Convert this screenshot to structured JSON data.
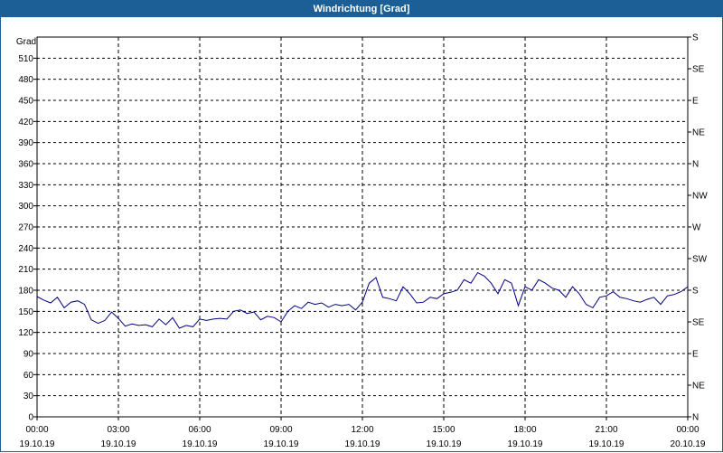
{
  "window": {
    "title": "Windrichtung [Grad]"
  },
  "chart_data": {
    "type": "line",
    "title": "Windrichtung [Grad]",
    "ylabel": "Grad",
    "ylim": [
      0,
      540
    ],
    "y_ticks": [
      0,
      30,
      60,
      90,
      120,
      150,
      180,
      210,
      240,
      270,
      300,
      330,
      360,
      390,
      420,
      450,
      480,
      510
    ],
    "y_ticks_right": [
      "N",
      "NE",
      "E",
      "SE",
      "S",
      "SW",
      "W",
      "NW",
      "N",
      "NE",
      "E",
      "SE",
      "S"
    ],
    "x_ticks": [
      {
        "time": "00:00",
        "date": "19.10.19"
      },
      {
        "time": "03:00",
        "date": "19.10.19"
      },
      {
        "time": "06:00",
        "date": "19.10.19"
      },
      {
        "time": "09:00",
        "date": "19.10.19"
      },
      {
        "time": "12:00",
        "date": "19.10.19"
      },
      {
        "time": "15:00",
        "date": "19.10.19"
      },
      {
        "time": "18:00",
        "date": "19.10.19"
      },
      {
        "time": "21:00",
        "date": "19.10.19"
      },
      {
        "time": "00:00",
        "date": "20.10.19"
      }
    ],
    "grid": true,
    "series": [
      {
        "color": "#000080",
        "x_hours": [
          0,
          0.25,
          0.5,
          0.75,
          1,
          1.25,
          1.5,
          1.75,
          2,
          2.25,
          2.5,
          2.75,
          3,
          3.25,
          3.5,
          3.75,
          4,
          4.25,
          4.5,
          4.75,
          5,
          5.25,
          5.5,
          5.75,
          6,
          6.25,
          6.5,
          6.75,
          7,
          7.25,
          7.5,
          7.75,
          8,
          8.25,
          8.5,
          8.75,
          9,
          9.25,
          9.5,
          9.75,
          10,
          10.25,
          10.5,
          10.75,
          11,
          11.25,
          11.5,
          11.75,
          12,
          12.25,
          12.5,
          12.75,
          13,
          13.25,
          13.5,
          13.75,
          14,
          14.25,
          14.5,
          14.75,
          15,
          15.25,
          15.5,
          15.75,
          16,
          16.25,
          16.5,
          16.75,
          17,
          17.25,
          17.5,
          17.75,
          18,
          18.25,
          18.5,
          18.75,
          19,
          19.25,
          19.5,
          19.75,
          20,
          20.25,
          20.5,
          20.75,
          21,
          21.25,
          21.5,
          21.75,
          22,
          22.25,
          22.5,
          22.75,
          23,
          23.25,
          23.5,
          23.75,
          24
        ],
        "y": [
          171,
          166,
          162,
          170,
          155,
          163,
          165,
          160,
          138,
          133,
          137,
          149,
          140,
          129,
          132,
          130,
          131,
          128,
          139,
          131,
          141,
          126,
          130,
          128,
          139,
          137,
          139,
          140,
          139,
          150,
          152,
          147,
          149,
          138,
          143,
          141,
          135,
          150,
          158,
          154,
          163,
          160,
          162,
          156,
          160,
          158,
          160,
          152,
          163,
          190,
          198,
          170,
          168,
          165,
          185,
          175,
          162,
          163,
          170,
          168,
          175,
          177,
          180,
          195,
          190,
          205,
          200,
          190,
          175,
          195,
          190,
          158,
          185,
          180,
          195,
          190,
          183,
          180,
          170,
          185,
          175,
          160,
          155,
          170,
          172,
          178,
          170,
          168,
          165,
          163,
          167,
          170,
          160,
          172,
          174,
          178,
          185,
          188,
          190,
          183,
          185,
          180
        ]
      }
    ]
  }
}
